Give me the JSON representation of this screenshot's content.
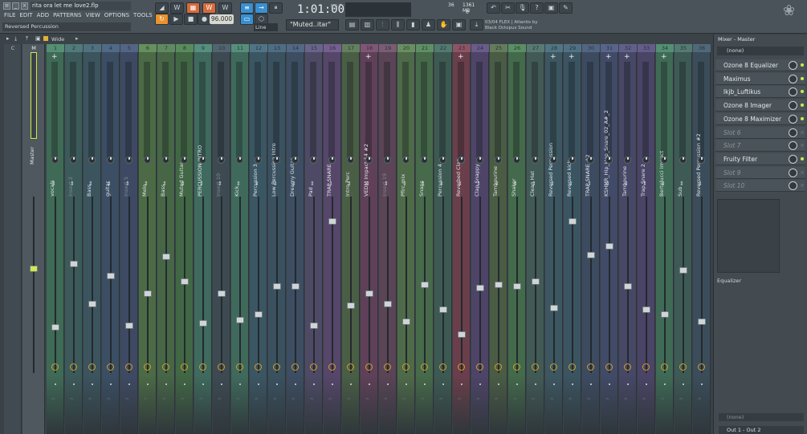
{
  "window": {
    "file_title": "rita ora let me love2.flp",
    "hint": "Reversed Percussion"
  },
  "menu": [
    "FILE",
    "EDIT",
    "ADD",
    "PATTERNS",
    "VIEW",
    "OPTIONS",
    "TOOLS",
    "?"
  ],
  "transport": {
    "tempo": "96.000",
    "time": "1:01:00",
    "time_unit": "B:S:T",
    "snap": "Line",
    "pattern": "\"Muted..itar\""
  },
  "cpu": {
    "cpu_value": "36",
    "memory": "1361 MB",
    "voices": "0"
  },
  "news": {
    "line1": "03/04  FLEX | Atlantis by",
    "line2": "Black Octopus Sound"
  },
  "mixer_toolbar": {
    "view_mode": "Wide"
  },
  "channel_header_labels": [
    "C",
    "M"
  ],
  "channels": [
    {
      "num": "1",
      "name": "vocals",
      "dim": false,
      "color": "#3f6a56",
      "add": true,
      "fader": 0.26
    },
    {
      "num": "2",
      "name": "Insert 2",
      "dim": true,
      "color": "#3c5a5a",
      "add": false,
      "fader": 0.62
    },
    {
      "num": "3",
      "name": "Bass",
      "dim": false,
      "color": "#3b545e",
      "add": false,
      "fader": 0.39
    },
    {
      "num": "4",
      "name": "guitar",
      "dim": false,
      "color": "#3b4e63",
      "add": false,
      "fader": 0.55
    },
    {
      "num": "5",
      "name": "Insert 5",
      "dim": true,
      "color": "#3e4a63",
      "add": false,
      "fader": 0.27
    },
    {
      "num": "6",
      "name": "Melo",
      "dim": false,
      "color": "#4b6a45",
      "add": false,
      "fader": 0.45
    },
    {
      "num": "7",
      "name": "Bass",
      "dim": false,
      "color": "#466646",
      "add": false,
      "fader": 0.66
    },
    {
      "num": "8",
      "name": "Muted Guitar",
      "dim": false,
      "color": "#426744",
      "add": false,
      "fader": 0.52
    },
    {
      "num": "9",
      "name": "PERCUSSION INTRO",
      "dim": false,
      "color": "#3f6a5d",
      "add": false,
      "fader": 0.28
    },
    {
      "num": "10",
      "name": "Insert 10",
      "dim": true,
      "color": "#3d4a52",
      "add": false,
      "fader": 0.45
    },
    {
      "num": "11",
      "name": "Kick",
      "dim": false,
      "color": "#3f6a5b",
      "add": false,
      "fader": 0.3
    },
    {
      "num": "12",
      "name": "Percussion 3",
      "dim": false,
      "color": "#3b5663",
      "add": false,
      "fader": 0.33
    },
    {
      "num": "13",
      "name": "Low Percussion Intro",
      "dim": false,
      "color": "#3a5160",
      "add": false,
      "fader": 0.49
    },
    {
      "num": "14",
      "name": "Dreamy Guitar",
      "dim": false,
      "color": "#3d4d62",
      "add": false,
      "fader": 0.49
    },
    {
      "num": "15",
      "name": "Pad",
      "dim": false,
      "color": "#4e4a66",
      "add": false,
      "fader": 0.27
    },
    {
      "num": "16",
      "name": "TRAP SNARE",
      "dim": false,
      "color": "#56466a",
      "add": false,
      "fader": 0.86
    },
    {
      "num": "17",
      "name": "Intro Perc",
      "dim": false,
      "color": "#4a5e45",
      "add": false,
      "fader": 0.38
    },
    {
      "num": "18",
      "name": "VEDM Impact 14 #2",
      "dim": false,
      "color": "#5f4058",
      "add": true,
      "fader": 0.45
    },
    {
      "num": "19",
      "name": "Insert 19",
      "dim": true,
      "color": "#5a4456",
      "add": false,
      "fader": 0.39
    },
    {
      "num": "20",
      "name": "Pfirc mix",
      "dim": false,
      "color": "#4e6a48",
      "add": false,
      "fader": 0.29
    },
    {
      "num": "21",
      "name": "Snaps",
      "dim": false,
      "color": "#466a4a",
      "add": false,
      "fader": 0.5
    },
    {
      "num": "22",
      "name": "Percussion 4",
      "dim": false,
      "color": "#3d5a52",
      "add": false,
      "fader": 0.36
    },
    {
      "num": "23",
      "name": "Reverbed Clap",
      "dim": false,
      "color": "#6a3e4a",
      "add": true,
      "fader": 0.22
    },
    {
      "num": "24",
      "name": "Clap Snappy",
      "dim": false,
      "color": "#4e4468",
      "add": false,
      "fader": 0.48
    },
    {
      "num": "25",
      "name": "Tambourine",
      "dim": false,
      "color": "#4a5c44",
      "add": false,
      "fader": 0.5
    },
    {
      "num": "26",
      "name": "Shaker",
      "dim": false,
      "color": "#436a4a",
      "add": false,
      "fader": 0.49
    },
    {
      "num": "27",
      "name": "Clean Hat",
      "dim": false,
      "color": "#425a55",
      "add": false,
      "fader": 0.52
    },
    {
      "num": "28",
      "name": "Reversed Percussion",
      "dim": false,
      "color": "#3c5761",
      "add": true,
      "fader": 0.37
    },
    {
      "num": "29",
      "name": "Reversed kick",
      "dim": false,
      "color": "#3b5461",
      "add": true,
      "fader": 0.86
    },
    {
      "num": "30",
      "name": "TRAP SNARE  #2",
      "dim": false,
      "color": "#3d4b61",
      "add": false,
      "fader": 0.67
    },
    {
      "num": "31",
      "name": "KSHMR_Hip_Hop_Snare_02_A#_2",
      "dim": false,
      "color": "#414a66",
      "add": true,
      "fader": 0.72
    },
    {
      "num": "32",
      "name": "Tambourine",
      "dim": false,
      "color": "#474766",
      "add": true,
      "fader": 0.49
    },
    {
      "num": "33",
      "name": "Trap Snare 2",
      "dim": false,
      "color": "#4a4466",
      "add": false,
      "fader": 0.36
    },
    {
      "num": "34",
      "name": "Bertolucci Impact",
      "dim": false,
      "color": "#3f6a55",
      "add": true,
      "fader": 0.33
    },
    {
      "num": "35",
      "name": "Sub",
      "dim": false,
      "color": "#3e5a55",
      "add": false,
      "fader": 0.58
    },
    {
      "num": "36",
      "name": "Reversed Percussion #2",
      "dim": false,
      "color": "#3b4d5a",
      "add": false,
      "fader": 0.29
    }
  ],
  "master": {
    "name": "Master",
    "fader": 0.59
  },
  "right_panel": {
    "title": "Mixer - Master",
    "preset": "(none)",
    "slots": [
      {
        "label": "Ozone 8 Equalizer",
        "empty": false
      },
      {
        "label": "Maximus",
        "empty": false
      },
      {
        "label": "lkjb_Luftikus",
        "empty": false
      },
      {
        "label": "Ozone 8 Imager",
        "empty": false
      },
      {
        "label": "Ozone 8 Maximizer",
        "empty": false
      },
      {
        "label": "Slot 6",
        "empty": true
      },
      {
        "label": "Slot 7",
        "empty": true
      },
      {
        "label": "Fruity Filter",
        "empty": false
      },
      {
        "label": "Slot 9",
        "empty": true
      },
      {
        "label": "Slot 10",
        "empty": true
      }
    ],
    "eq_label": "Equalizer",
    "input": "(none)",
    "output": "Out 1 - Out 2"
  },
  "colors": {
    "accent_led": "#d2e84d",
    "fader_cap": "#cfd4d6",
    "bg": "#3a4248"
  }
}
